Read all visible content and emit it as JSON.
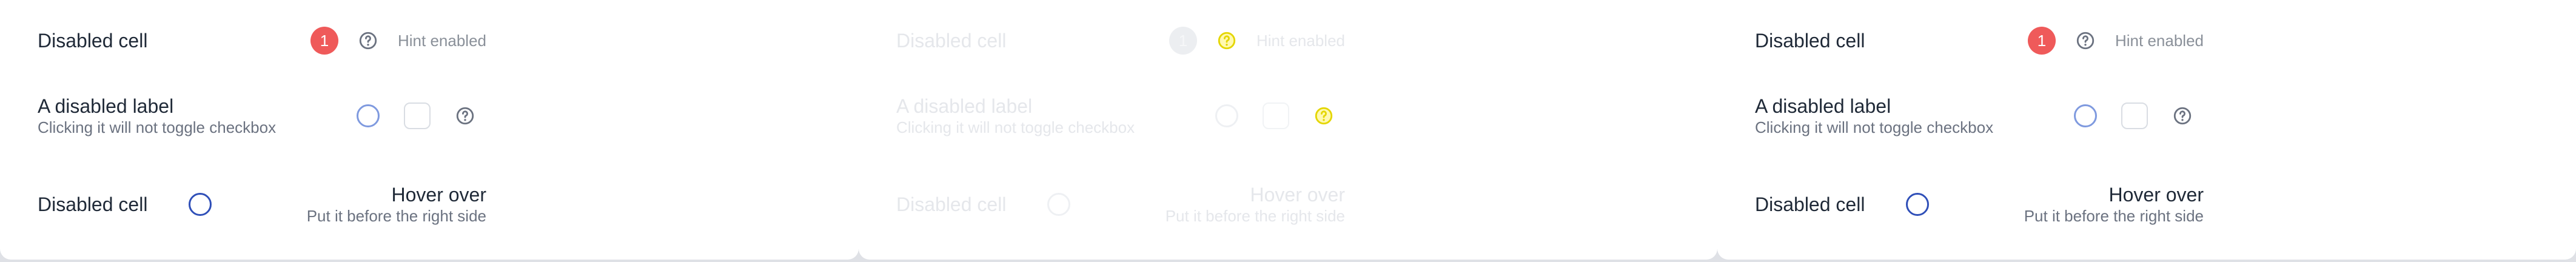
{
  "panels": [
    {
      "state": "enabled",
      "rows": [
        {
          "title": "Disabled cell",
          "badge": "1",
          "hint": "Hint enabled"
        },
        {
          "title": "A disabled label",
          "subtitle": "Clicking it will not toggle checkbox"
        },
        {
          "title": "Disabled cell",
          "right_title": "Hover over",
          "right_subtitle": "Put it before the right side"
        }
      ]
    },
    {
      "state": "disabled",
      "rows": [
        {
          "title": "Disabled cell",
          "badge": "1",
          "hint": "Hint enabled"
        },
        {
          "title": "A disabled label",
          "subtitle": "Clicking it will not toggle checkbox"
        },
        {
          "title": "Disabled cell",
          "right_title": "Hover over",
          "right_subtitle": "Put it before the right side"
        }
      ]
    },
    {
      "state": "enabled",
      "rows": [
        {
          "title": "Disabled cell",
          "badge": "1",
          "hint": "Hint enabled"
        },
        {
          "title": "A disabled label",
          "subtitle": "Clicking it will not toggle checkbox"
        },
        {
          "title": "Disabled cell",
          "right_title": "Hover over",
          "right_subtitle": "Put it before the right side"
        }
      ]
    }
  ],
  "colors": {
    "badge": "#ef5a5a",
    "radio_border": "#2f4fb8",
    "hint_icon_accent": "#e4d600"
  },
  "icons": {
    "hint": "question-circle-icon"
  }
}
